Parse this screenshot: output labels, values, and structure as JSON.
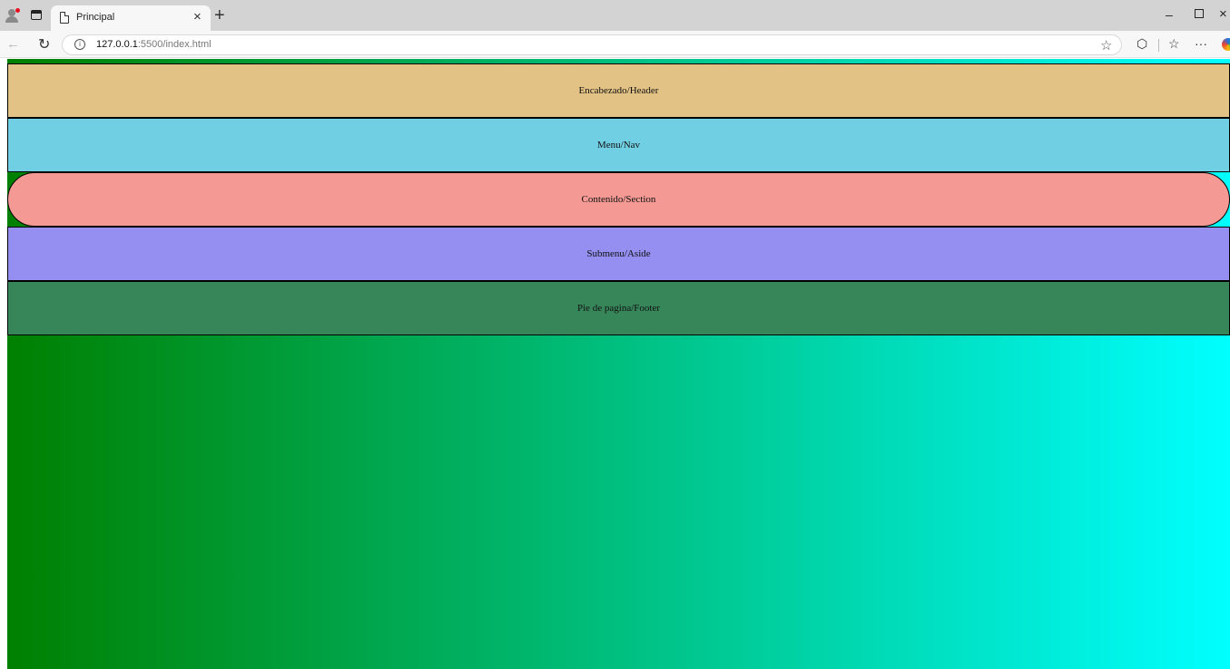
{
  "browser": {
    "tab_title": "Principal",
    "tab_close": "×",
    "new_tab": "+",
    "url_host": "127.0.0.1",
    "url_path": ":5500/index.html",
    "window_min": "–",
    "window_close": "×",
    "icons": [
      "profile-icon",
      "tab-actions-icon",
      "document-icon",
      "back-arrow-icon",
      "refresh-icon",
      "info-icon",
      "star-icon",
      "extensions-icon",
      "favorites-icon",
      "more-icon",
      "copilot-icon"
    ]
  },
  "page": {
    "background_gradient": [
      "#008000",
      "#00ffff"
    ],
    "sections": {
      "header": {
        "label": "Encabezado/Header",
        "color": "#e3c285"
      },
      "nav": {
        "label": "Menu/Nav",
        "color": "#71cfe4"
      },
      "section": {
        "label": "Contenido/Section",
        "color": "#f49993"
      },
      "aside": {
        "label": "Submenu/Aside",
        "color": "#948ff0"
      },
      "footer": {
        "label": "Pie de pagina/Footer",
        "color": "#37865a"
      }
    }
  }
}
